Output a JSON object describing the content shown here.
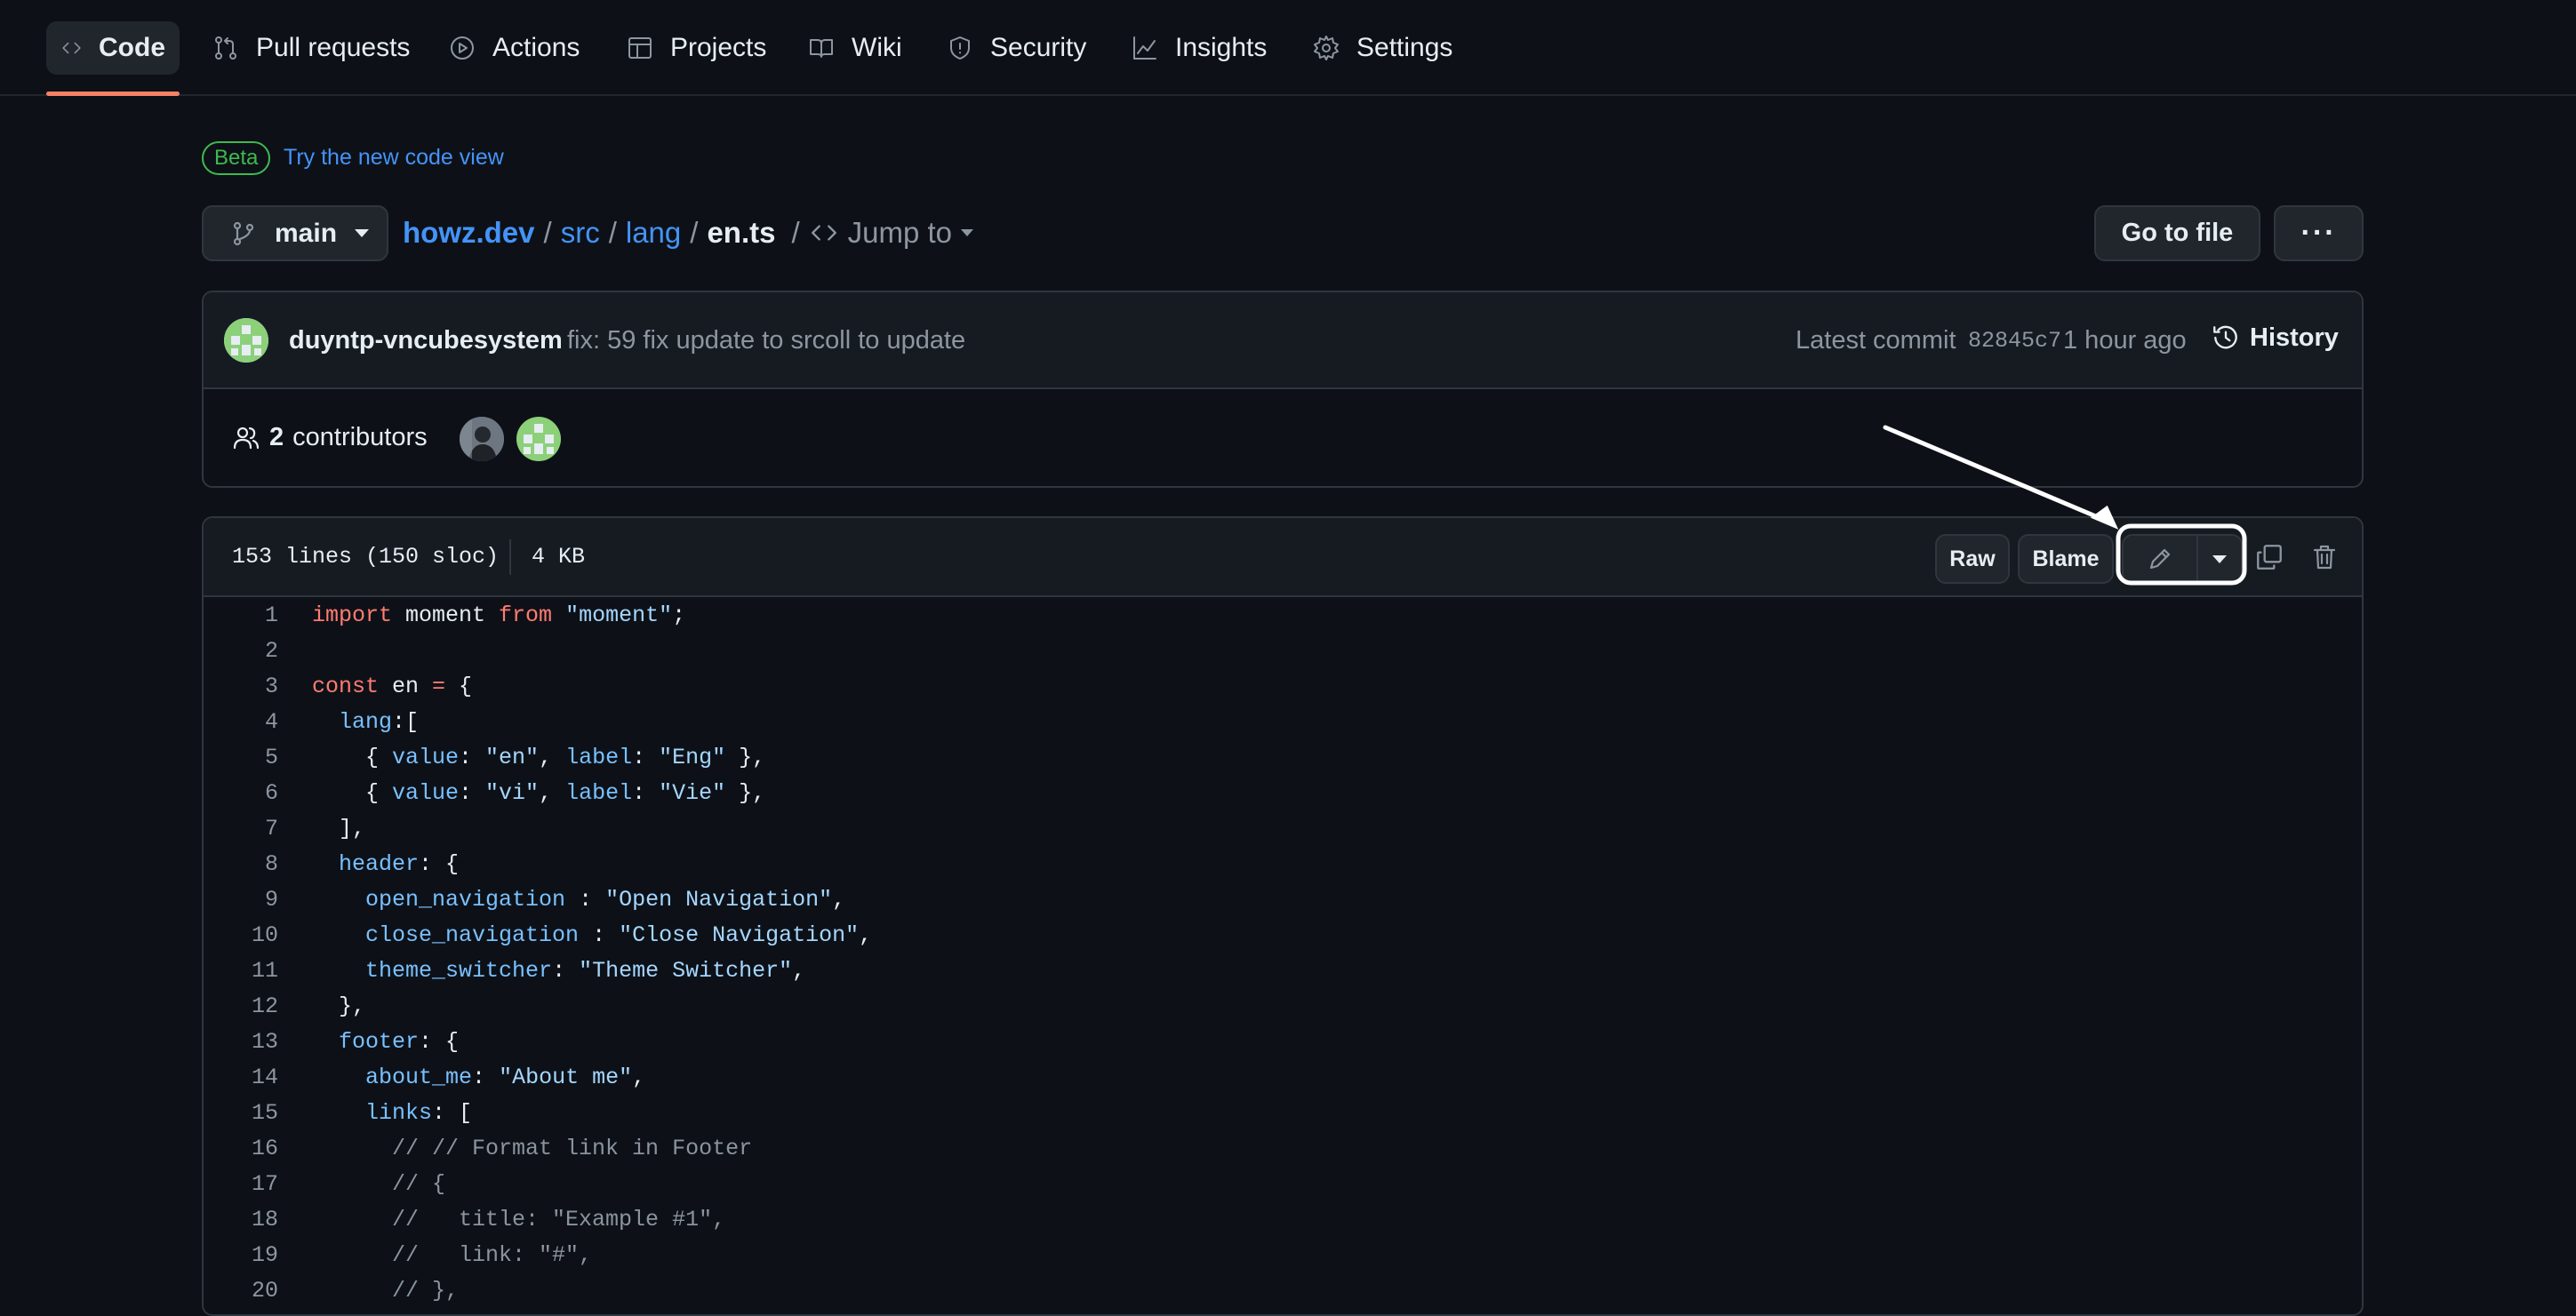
{
  "nav": {
    "tabs": [
      {
        "label": "Code",
        "icon": "code-icon"
      },
      {
        "label": "Pull requests",
        "icon": "git-pull-request-icon"
      },
      {
        "label": "Actions",
        "icon": "play-icon"
      },
      {
        "label": "Projects",
        "icon": "table-icon"
      },
      {
        "label": "Wiki",
        "icon": "book-icon"
      },
      {
        "label": "Security",
        "icon": "shield-icon"
      },
      {
        "label": "Insights",
        "icon": "graph-icon"
      },
      {
        "label": "Settings",
        "icon": "gear-icon"
      }
    ]
  },
  "beta": {
    "badge": "Beta",
    "link": "Try the new code view"
  },
  "branch": {
    "name": "main"
  },
  "breadcrumb": {
    "repo": "howz.dev",
    "sep": "/",
    "dir1": "src",
    "dir2": "lang",
    "file": "en.ts",
    "jump": "Jump to"
  },
  "actions": {
    "go_to_file": "Go to file",
    "more": "···"
  },
  "commit": {
    "author": "duyntp-vncubesystem",
    "message": "fix: 59 fix update to srcoll to update",
    "latest_label": "Latest commit",
    "sha": "82845c7",
    "time": "1 hour ago",
    "history": "History"
  },
  "contributors": {
    "count": "2",
    "label": "contributors"
  },
  "file_info": {
    "lines": "153 lines (150 sloc)",
    "size": "4 KB"
  },
  "file_actions": {
    "raw": "Raw",
    "blame": "Blame"
  },
  "code": {
    "line_numbers": [
      "1",
      "2",
      "3",
      "4",
      "5",
      "6",
      "7",
      "8",
      "9",
      "10",
      "11",
      "12",
      "13",
      "14",
      "15",
      "16",
      "17",
      "18",
      "19",
      "20"
    ]
  },
  "colors": {
    "accent": "#f78166",
    "link": "#4493f8",
    "beta": "#3fb950",
    "background": "#0d1117"
  }
}
